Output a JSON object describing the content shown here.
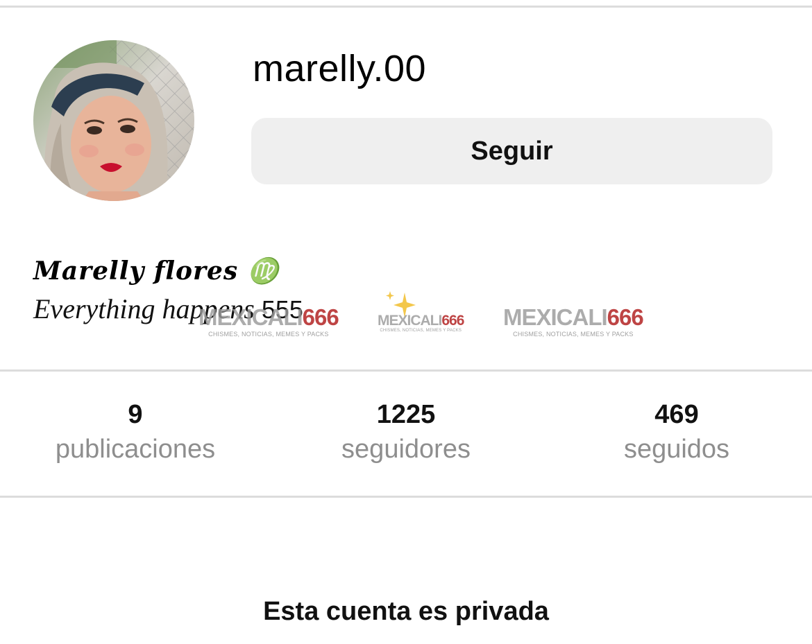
{
  "profile": {
    "username": "marelly.00",
    "follow_label": "Seguir",
    "avatar_icon": "profile-photo"
  },
  "bio": {
    "name": "𝑴𝒂𝒓𝒆𝒍𝒍𝒚 𝒇𝒍𝒐𝒓𝒆𝒔 ♍",
    "line_text": "Everything happens",
    "line_number": "555"
  },
  "watermark": {
    "brand_a": "MEXICALI",
    "brand_b": "666",
    "tagline": "CHISMES, NOTICIAS, MEMES Y PACKS",
    "sparkle_icon": "sparkle-icon"
  },
  "stats": {
    "posts_value": "9",
    "posts_label": "publicaciones",
    "followers_value": "1225",
    "followers_label": "seguidores",
    "following_value": "469",
    "following_label": "seguidos"
  },
  "private_notice": "Esta cuenta es privada",
  "colors": {
    "button_bg": "#efefef",
    "divider": "#dcdcdc",
    "secondary_text": "#8e8e8e",
    "watermark_red": "#b01c1c"
  }
}
